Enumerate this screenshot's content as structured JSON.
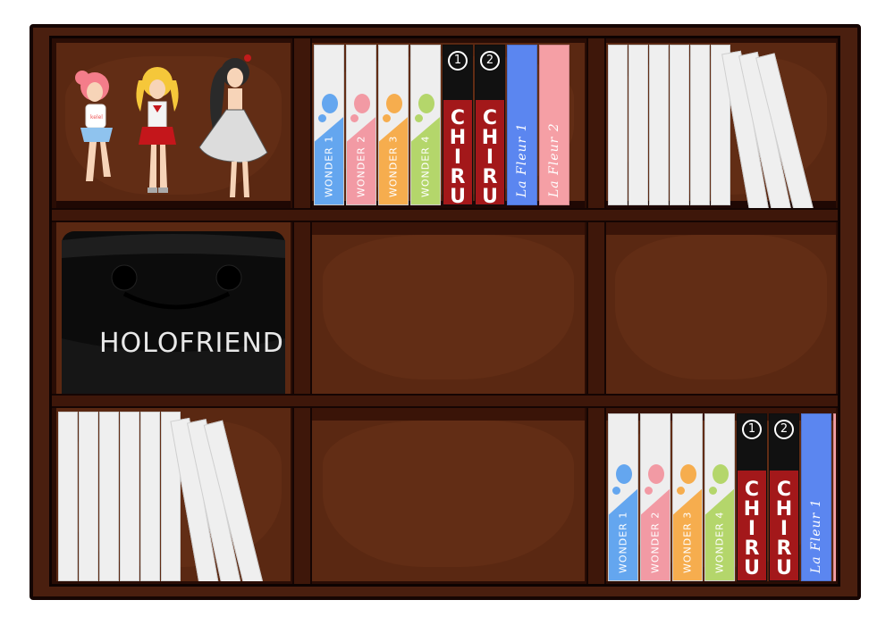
{
  "scene": {
    "colors": {
      "frame": "#4a1f0f",
      "cubby": "#5a2812",
      "wonder": [
        "#64a6ef",
        "#f29aa4",
        "#f6ad4e",
        "#b4d66b"
      ],
      "chiru_red": "#a3181a",
      "fleur": [
        "#5b86f0",
        "#f59fa5"
      ]
    }
  },
  "figures": {
    "pink_girl": {
      "name": "pink-hair-figure",
      "shirt_text": "kelel"
    },
    "blonde_girl": {
      "name": "blonde-figure"
    },
    "dark_girl": {
      "name": "dark-hair-figure"
    }
  },
  "bag": {
    "label": "HOLOFRIEND"
  },
  "books": {
    "wonder": [
      "WONDER 1",
      "WONDER 2",
      "WONDER 3",
      "WONDER 4"
    ],
    "chiru": [
      {
        "num": "1",
        "title": "CHIRU"
      },
      {
        "num": "2",
        "title": "CHIRU"
      }
    ],
    "fleur": [
      "La Fleur 1",
      "La Fleur 2"
    ]
  }
}
